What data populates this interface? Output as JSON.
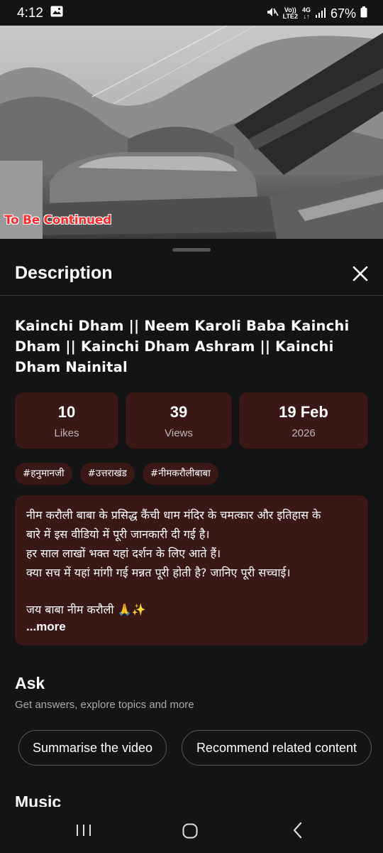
{
  "status": {
    "time": "4:12",
    "volte": "Vo))",
    "lte": "LTE2",
    "net": "4G",
    "battery": "67%"
  },
  "video": {
    "overlay_text": "To Be Continued"
  },
  "sheet": {
    "title": "Description",
    "video_title": "Kainchi Dham || Neem Karoli Baba Kainchi Dham || Kainchi Dham Ashram || Kainchi Dham Nainital",
    "stats": [
      {
        "value": "10",
        "label": "Likes"
      },
      {
        "value": "39",
        "label": "Views"
      },
      {
        "value": "19 Feb",
        "label": "2026"
      }
    ],
    "tags": [
      "#हनुमानजी",
      "#उत्तराखंड",
      "#नीमकरौलीबाबा"
    ],
    "description": {
      "lines": [
        "नीम करौली बाबा के प्रसिद्ध कैंची धाम मंदिर के चमत्कार और इतिहास के",
        "बारे में इस वीडियो में पूरी जानकारी दी गई है।",
        "हर साल लाखों भक्त यहां दर्शन के लिए आते हैं।",
        "क्या सच में यहां मांगी गई मन्नत पूरी होती है? जानिए पूरी सच्चाई।"
      ],
      "closing": "जय बाबा नीम करौली 🙏✨",
      "more_label": "...more"
    },
    "ask": {
      "title": "Ask",
      "subtitle": "Get answers, explore topics and more",
      "chips": [
        "Summarise the video",
        "Recommend related content"
      ]
    },
    "music": {
      "title": "Music"
    }
  },
  "colors": {
    "background": "#141414",
    "card": "#3a1816",
    "overlay_red": "#ff2a2a"
  }
}
